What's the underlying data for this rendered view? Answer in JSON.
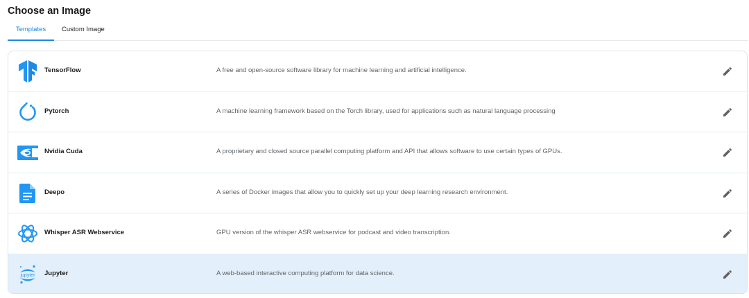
{
  "page": {
    "title": "Choose an Image"
  },
  "tabs": [
    {
      "label": "Templates",
      "active": true
    },
    {
      "label": "Custom Image",
      "active": false
    }
  ],
  "templates": [
    {
      "name": "TensorFlow",
      "description": "A free and open-source software library for machine learning and artificial intelligence.",
      "icon": "tensorflow-icon"
    },
    {
      "name": "Pytorch",
      "description": "A machine learning framework based on the Torch library, used for applications such as natural language processing",
      "icon": "pytorch-icon"
    },
    {
      "name": "Nvidia Cuda",
      "description": "A proprietary and closed source parallel computing platform and API that allows software to use certain types of GPUs.",
      "icon": "nvidia-icon"
    },
    {
      "name": "Deepo",
      "description": "A series of Docker images that allow you to quickly set up your deep learning research environment.",
      "icon": "document-icon"
    },
    {
      "name": "Whisper ASR Webservice",
      "description": "GPU version of the whisper ASR webservice for podcast and video transcription.",
      "icon": "openai-icon"
    },
    {
      "name": "Jupyter",
      "description": "A web-based interactive computing platform for data science.",
      "icon": "jupyter-icon",
      "logo_text": "jupyter",
      "selected": true
    }
  ],
  "colors": {
    "accent": "#1e88e5",
    "selected_row": "#e3effa",
    "icon": "#2196f3",
    "edit_icon": "#616161"
  }
}
